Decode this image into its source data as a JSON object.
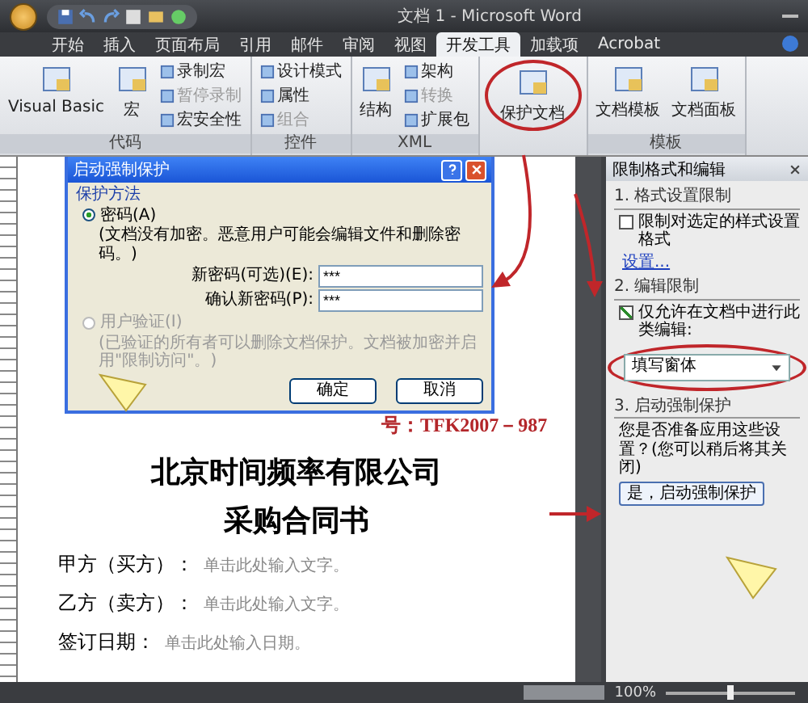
{
  "window": {
    "title": "文档 1 - Microsoft Word"
  },
  "tabs": [
    {
      "label": "开始",
      "selected": false
    },
    {
      "label": "插入",
      "selected": false
    },
    {
      "label": "页面布局",
      "selected": false
    },
    {
      "label": "引用",
      "selected": false
    },
    {
      "label": "邮件",
      "selected": false
    },
    {
      "label": "审阅",
      "selected": false
    },
    {
      "label": "视图",
      "selected": false
    },
    {
      "label": "开发工具",
      "selected": true
    },
    {
      "label": "加载项",
      "selected": false
    },
    {
      "label": "Acrobat",
      "selected": false
    }
  ],
  "ribbon_groups": [
    {
      "label": "代码",
      "items": [
        {
          "kind": "large",
          "label": "Visual Basic",
          "disabled": false
        },
        {
          "kind": "large",
          "label": "宏",
          "disabled": false
        },
        {
          "kind": "small",
          "label": "录制宏",
          "disabled": false
        },
        {
          "kind": "small",
          "label": "暂停录制",
          "disabled": true
        },
        {
          "kind": "small",
          "label": "宏安全性",
          "disabled": false
        }
      ]
    },
    {
      "label": "控件",
      "items": [
        {
          "kind": "small",
          "label": "设计模式",
          "disabled": false
        },
        {
          "kind": "small",
          "label": "属性",
          "disabled": false
        },
        {
          "kind": "small",
          "label": "组合",
          "disabled": true
        }
      ]
    },
    {
      "label": "XML",
      "items": [
        {
          "kind": "large",
          "label": "结构",
          "disabled": false
        },
        {
          "kind": "small",
          "label": "架构",
          "disabled": false
        },
        {
          "kind": "small",
          "label": "转换",
          "disabled": true
        },
        {
          "kind": "small",
          "label": "扩展包",
          "disabled": false
        }
      ]
    },
    {
      "items": [
        {
          "kind": "large",
          "label": "保护文档",
          "disabled": false,
          "highlighted": true
        }
      ]
    },
    {
      "label": "模板",
      "items": [
        {
          "kind": "large",
          "label": "文档模板",
          "disabled": false
        },
        {
          "kind": "large",
          "label": "文档面板",
          "disabled": false
        }
      ]
    }
  ],
  "dialog": {
    "title": "启动强制保护",
    "section": "保护方法",
    "options": [
      {
        "label": "密码(A)",
        "selected": true,
        "disabled": false,
        "note": "(文档没有加密。恶意用户可能会编辑文件和删除密码。)"
      },
      {
        "label": "用户验证(I)",
        "selected": false,
        "disabled": true,
        "note": "(已验证的所有者可以删除文档保护。文档被加密并启用\"限制访问\"。)"
      }
    ],
    "fields": [
      {
        "label": "新密码(可选)(E):",
        "value": "***"
      },
      {
        "label": "确认新密码(P):",
        "value": "***"
      }
    ],
    "buttons": [
      "确定",
      "取消"
    ]
  },
  "document": {
    "number": "号：TFK2007－987",
    "title": "北京时间频率有限公司",
    "subtitle": "采购合同书",
    "lines": [
      {
        "label": "甲方（买方）：",
        "placeholder": "单击此处输入文字。"
      },
      {
        "label": "乙方（卖方）：",
        "placeholder": "单击此处输入文字。"
      },
      {
        "label": "签订日期：",
        "placeholder": "单击此处输入日期。"
      }
    ]
  },
  "pane": {
    "title": "限制格式和编辑",
    "format_heading": "1. 格式设置限制",
    "format_option": {
      "label": "限制对选定的样式设置格式",
      "checked": false
    },
    "format_link": "设置...",
    "edit_heading": "2. 编辑限制",
    "edit_option": {
      "label": "仅允许在文档中进行此类编辑:",
      "checked": true
    },
    "edit_mode": "填写窗体",
    "enforce_heading": "3. 启动强制保护",
    "enforce_text": "您是否准备应用这些设置？(您可以稍后将其关闭)",
    "enforce_button": "是，启动强制保护"
  },
  "status_bar": {
    "zoom": "100%",
    "zoom_slider": {
      "level": 0.5
    }
  }
}
